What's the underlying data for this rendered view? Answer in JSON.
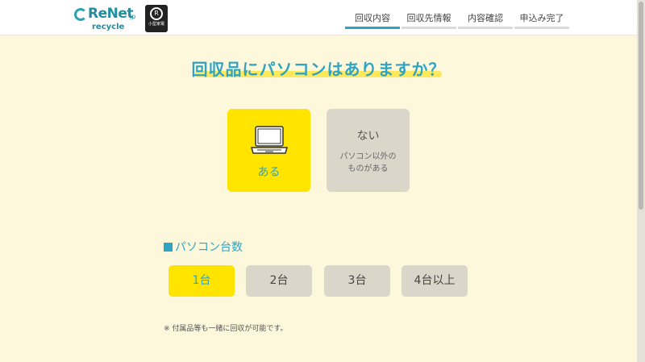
{
  "header": {
    "logo": {
      "name": "ReNet",
      "suffix": "jp",
      "subtitle": "recycle"
    },
    "badge": {
      "mark": "R",
      "text": "小型家電"
    },
    "steps": [
      {
        "label": "回収内容",
        "active": true
      },
      {
        "label": "回収先情報",
        "active": false
      },
      {
        "label": "内容確認",
        "active": false
      },
      {
        "label": "申込み完了",
        "active": false
      }
    ]
  },
  "main": {
    "title": "回収品にパソコンはありますか？",
    "choices": {
      "yes": {
        "label": "ある",
        "icon": "laptop-icon",
        "selected": true
      },
      "no": {
        "label": "ない",
        "sub1": "パソコン以外の",
        "sub2": "ものがある",
        "selected": false
      }
    },
    "count_section": {
      "heading": "パソコン台数",
      "options": [
        {
          "label": "1台",
          "selected": true
        },
        {
          "label": "2台",
          "selected": false
        },
        {
          "label": "3台",
          "selected": false
        },
        {
          "label": "4台以上",
          "selected": false
        }
      ]
    },
    "note": "※ 付属品等も一緒に回収が可能です。"
  },
  "colors": {
    "accent": "#2fa3c4",
    "selected_bg": "#ffe400",
    "unselected_bg": "#dad7ca",
    "page_bg": "#fdf7dc"
  }
}
